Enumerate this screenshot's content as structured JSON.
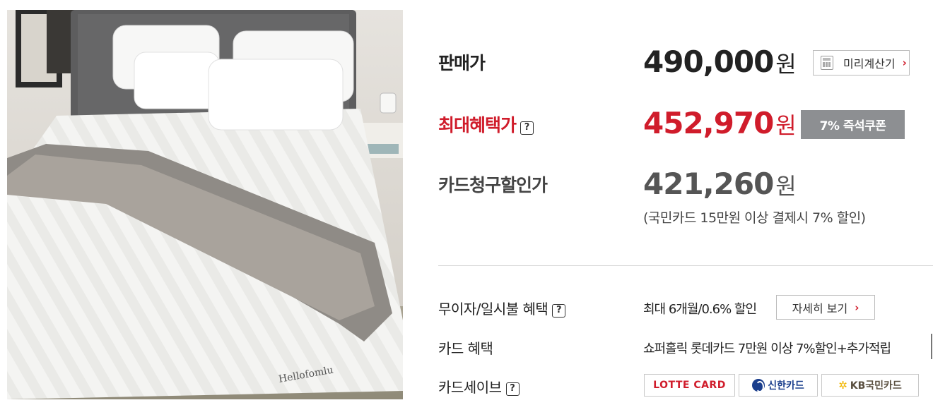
{
  "product_image": {
    "alt": "bedding-photo"
  },
  "price_rows": {
    "sale_label": "판매가",
    "sale_price": "490,000",
    "currency": "원",
    "calculator_label": "미리계산기",
    "max_benefit_label": "최대혜택가",
    "max_benefit_price": "452,970",
    "coupon_label": "7% 즉석쿠폰",
    "card_discount_label": "카드청구할인가",
    "card_discount_price": "421,260",
    "card_discount_note": "(국민카드 15만원 이상 결제시 7% 할인)",
    "help_glyph": "?"
  },
  "benefits": {
    "installment_label": "무이자/일시불 혜택",
    "installment_value": "최대 6개월/0.6% 할인",
    "detail_button": "자세히 보기",
    "card_benefit_label": "카드 혜택",
    "card_benefit_value": "쇼퍼홀릭 롯데카드 7만원 이상 7%할인+추가적립",
    "card_save_label": "카드세이브",
    "card_logos": [
      "LOTTE CARD",
      "신한카드",
      "KB국민카드"
    ]
  },
  "colors": {
    "accent_red": "#d01c2b",
    "coupon_gray": "#8d8f92"
  },
  "icons": [
    "calculator-icon",
    "help-icon",
    "chevron-right-icon"
  ]
}
